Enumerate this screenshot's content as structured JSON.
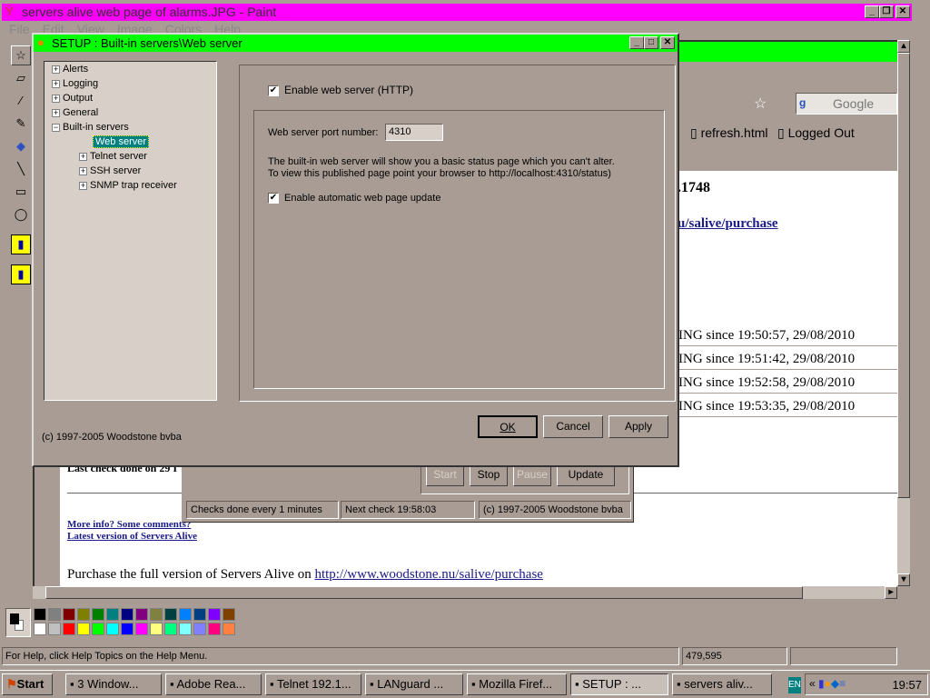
{
  "paint": {
    "title": "servers alive web page of alarms.JPG - Paint",
    "menu": [
      "File",
      "Edit",
      "View",
      "Image",
      "Colors",
      "Help"
    ],
    "status": "For Help, click Help Topics on the Help Menu.",
    "coords": "479,595",
    "palette": {
      "top": [
        "#000000",
        "#808080",
        "#800000",
        "#808000",
        "#008000",
        "#008080",
        "#000080",
        "#800080",
        "#808040",
        "#004040",
        "#0080ff",
        "#004080",
        "#8000ff",
        "#804000"
      ],
      "bottom": [
        "#ffffff",
        "#c0c0c0",
        "#ff0000",
        "#ffff00",
        "#00ff00",
        "#00ffff",
        "#0000ff",
        "#ff00ff",
        "#ffff80",
        "#00ff80",
        "#80ffff",
        "#8080ff",
        "#ff0080",
        "#ff8040"
      ]
    }
  },
  "capture": {
    "search_placeholder": "Google",
    "bookmarks": [
      "refresh.html",
      "Logged Out"
    ],
    "version_fragment": ".1748",
    "purchase_fragment": "u/salive/purchase",
    "rows": [
      "ING since 19:50:57, 29/08/2010",
      "ING since 19:51:42, 29/08/2010",
      "ING since 19:52:58, 29/08/2010",
      "ING since 19:53:35, 29/08/2010"
    ],
    "last_check": "Last check done on 29 I",
    "more_info": "More info? Some comments?",
    "latest_version": "Latest version of Servers Alive",
    "purchase_text": "Purchase the full version of Servers Alive on ",
    "purchase_link": "http://www.woodstone.nu/salive/purchase",
    "buttons": [
      "Start",
      "Stop",
      "Pause",
      "Update"
    ],
    "status": [
      "Checks done every  1 minutes",
      "Next check 19:58:03",
      "(c) 1997-2005 Woodstone bvba"
    ]
  },
  "dialog": {
    "title": "SETUP : Built-in servers\\Web server",
    "tree": [
      {
        "label": "Alerts",
        "level": 0
      },
      {
        "label": "Logging",
        "level": 0
      },
      {
        "label": "Output",
        "level": 0
      },
      {
        "label": "General",
        "level": 0
      },
      {
        "label": "Built-in servers",
        "level": 0,
        "expanded": true
      },
      {
        "label": "Web server",
        "level": 1,
        "selected": true
      },
      {
        "label": "Telnet server",
        "level": 1
      },
      {
        "label": "SSH server",
        "level": 1
      },
      {
        "label": "SNMP trap receiver",
        "level": 1
      }
    ],
    "enable_http": "Enable web server (HTTP)",
    "enable_http_checked": true,
    "port_label": "Web server port number:",
    "port_value": "4310",
    "info1": "The built-in web server will show you a basic status page which you can't alter.",
    "info2": "To view this published page point your browser to http://localhost:4310/status)",
    "auto_update": "Enable automatic web page update",
    "auto_update_checked": true,
    "copyright": "(c) 1997-2005 Woodstone bvba",
    "ok": "OK",
    "cancel": "Cancel",
    "apply": "Apply"
  },
  "taskbar": {
    "start": "Start",
    "items": [
      "3 Window...",
      "Adobe Rea...",
      "Telnet 192.1...",
      "LANguard ...",
      "Mozilla Firef...",
      "SETUP : ...",
      "servers aliv..."
    ],
    "lang": "EN",
    "clock": "19:57"
  }
}
